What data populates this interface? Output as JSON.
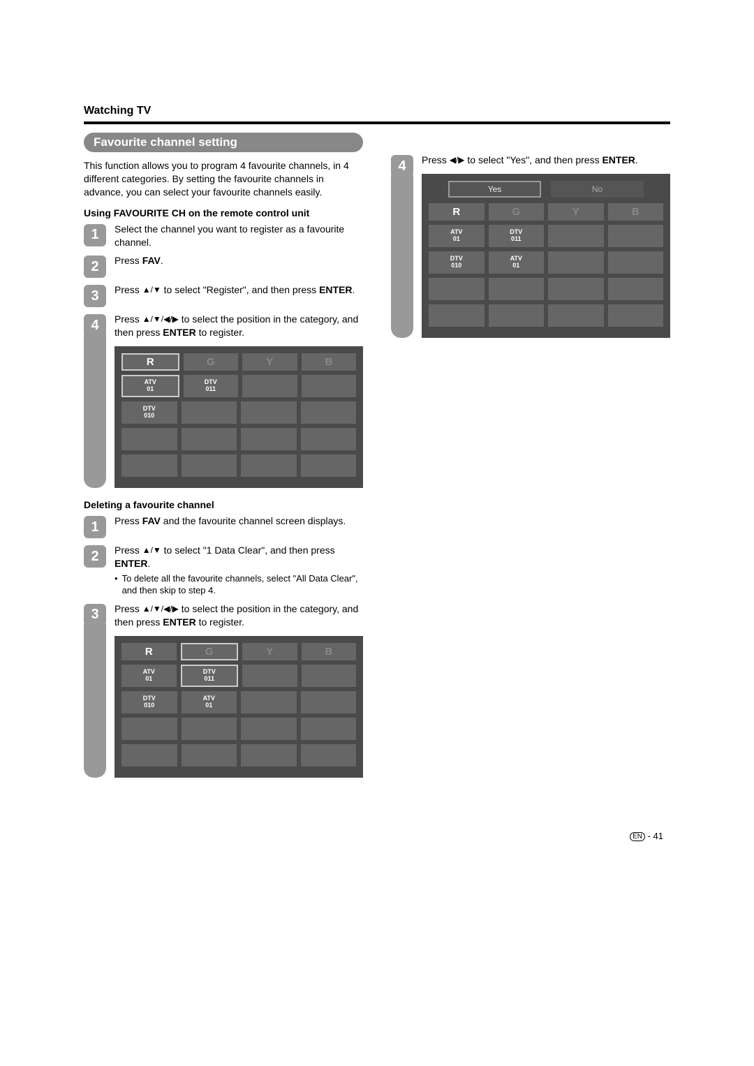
{
  "header": {
    "section": "Watching TV"
  },
  "title": "Favourite channel setting",
  "intro": "This function allows you to program 4 favourite channels, in 4 different categories. By setting the favourite channels in advance, you can select your favourite channels easily.",
  "using_heading": "Using FAVOURITE CH on the remote control unit",
  "steps_a": {
    "s1": "Select the channel you want to register as a favourite channel.",
    "s2_pre": "Press ",
    "s2_bold": "FAV",
    "s2_post": ".",
    "s3_pre": "Press ",
    "s3_mid": " to select \"Register\", and then press ",
    "s3_bold": "ENTER",
    "s3_post": ".",
    "s4_pre": "Press ",
    "s4_mid": " to select the position in the category, and then press ",
    "s4_bold": "ENTER",
    "s4_post": " to register."
  },
  "deleting_heading": "Deleting a favourite channel",
  "steps_b": {
    "s1_pre": "Press ",
    "s1_bold": "FAV",
    "s1_post": " and the favourite channel screen displays.",
    "s2_pre": "Press ",
    "s2_mid": " to select \"1 Data Clear\", and then press ",
    "s2_bold": "ENTER",
    "s2_post": ".",
    "s2_bullet": "To delete all the favourite channels, select \"All Data Clear\", and then skip to step 4.",
    "s3_pre": "Press ",
    "s3_mid": " to select the position in the category, and then press ",
    "s3_bold": "ENTER",
    "s3_post": " to register."
  },
  "right": {
    "s4_pre": "Press ",
    "s4_mid": " to select \"Yes\", and then press ",
    "s4_bold": "ENTER",
    "s4_post": "."
  },
  "tv": {
    "headers": [
      "R",
      "G",
      "Y",
      "B"
    ],
    "yes": "Yes",
    "no": "No",
    "atv01_a": "ATV",
    "atv01_b": "01",
    "dtv011_a": "DTV",
    "dtv011_b": "011",
    "dtv010_a": "DTV",
    "dtv010_b": "010",
    "atv01c_a": "ATV",
    "atv01c_b": "01"
  },
  "footer": {
    "lang": "EN",
    "sep": " - ",
    "page": "41"
  }
}
